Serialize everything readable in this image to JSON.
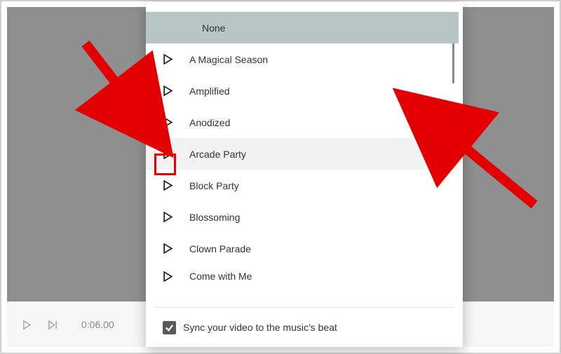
{
  "transport": {
    "timecode": "0:06.00"
  },
  "music": {
    "none_label": "None",
    "items": [
      {
        "label": "A Magical Season"
      },
      {
        "label": "Amplified"
      },
      {
        "label": "Anodized"
      },
      {
        "label": "Arcade Party",
        "hovered": true,
        "highlight": true
      },
      {
        "label": "Block Party"
      },
      {
        "label": "Blossoming"
      },
      {
        "label": "Clown Parade"
      },
      {
        "label": "Come with Me"
      }
    ],
    "sync_checked": true,
    "sync_label": "Sync your video to the music's beat"
  },
  "annotations": {
    "arrow_color": "#e30000"
  }
}
